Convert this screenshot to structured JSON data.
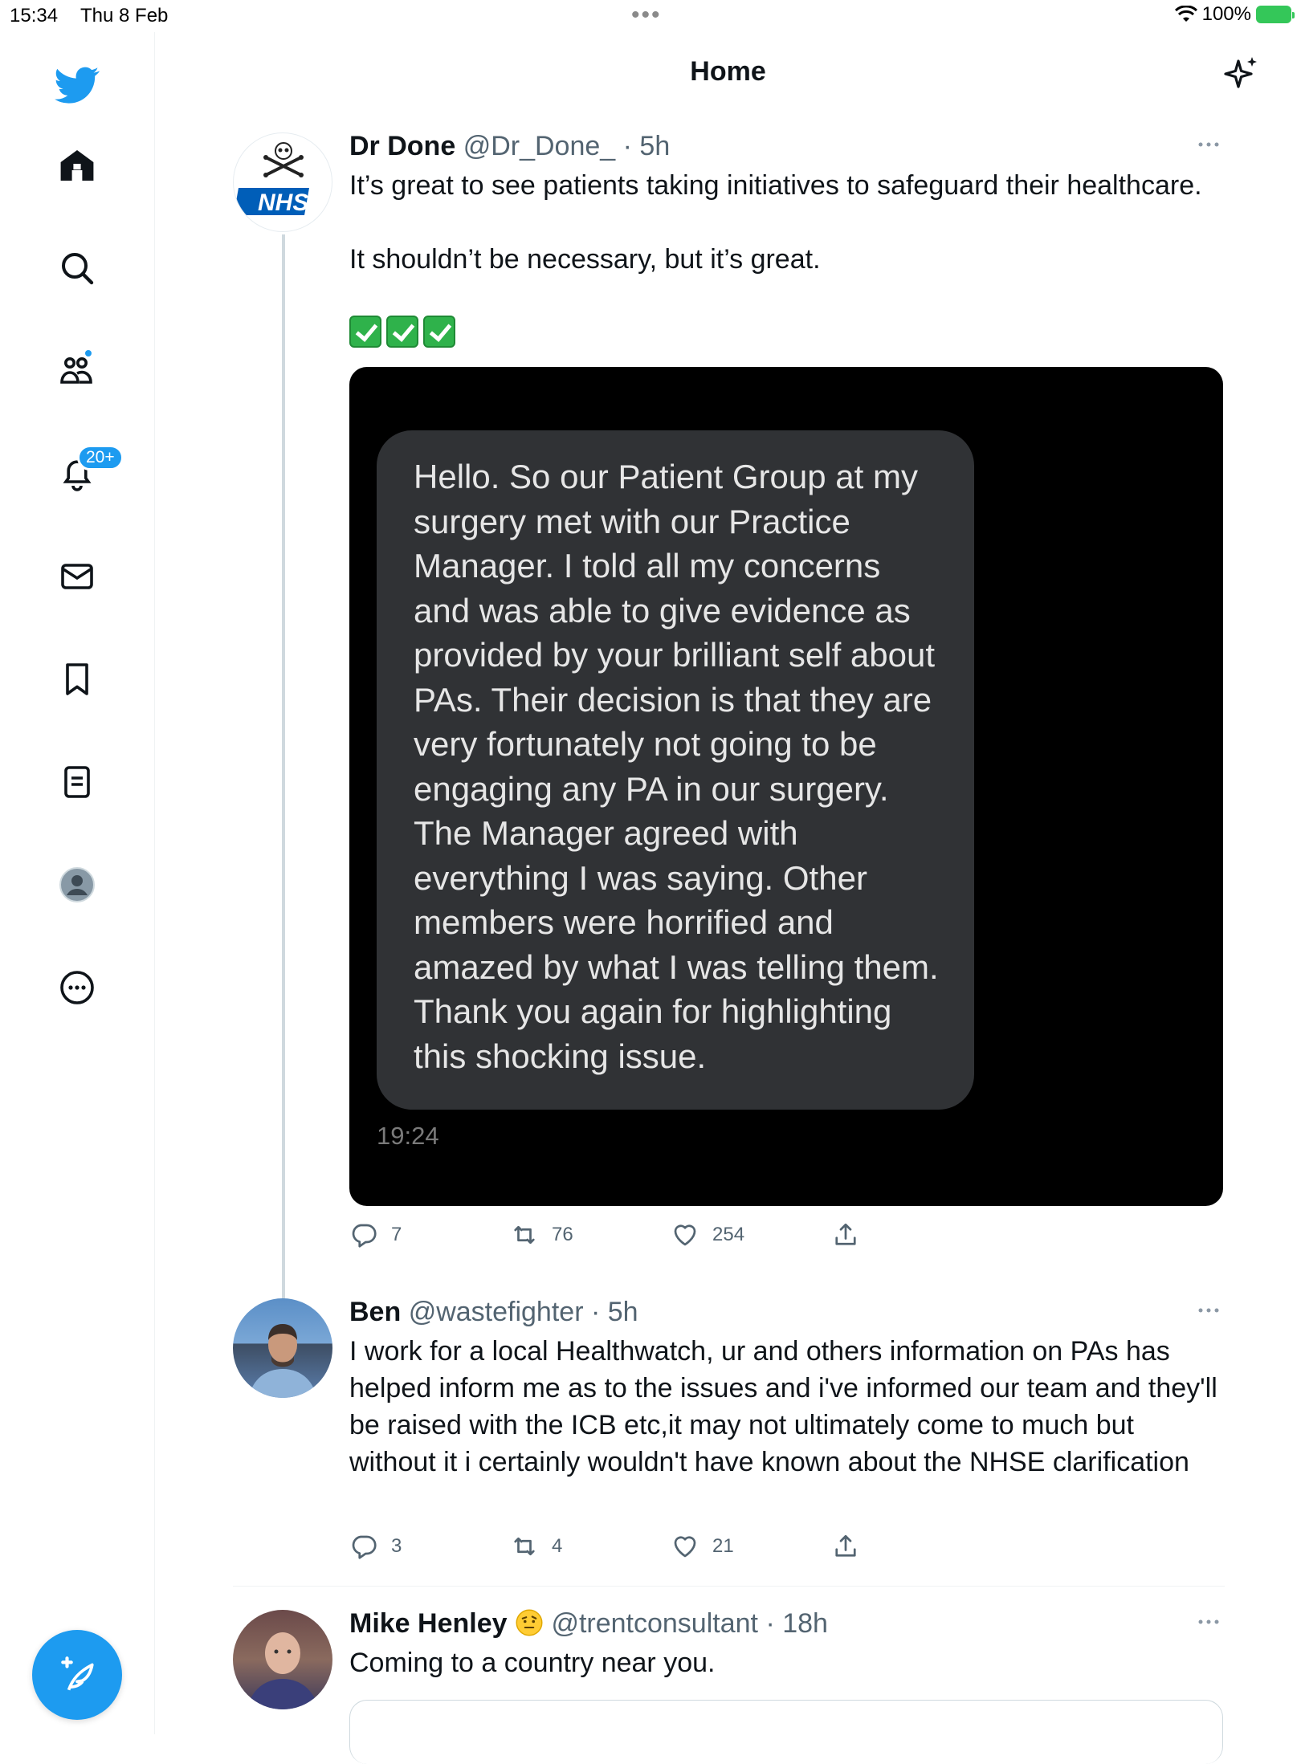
{
  "status_bar": {
    "time": "15:34",
    "date": "Thu 8 Feb",
    "battery": "100%"
  },
  "header": {
    "title": "Home"
  },
  "sidebar": {
    "notifications_badge": "20+",
    "icons": [
      "twitter-logo",
      "home-icon",
      "search-icon",
      "communities-icon",
      "notifications-icon",
      "messages-icon",
      "bookmarks-icon",
      "lists-icon",
      "profile-icon",
      "more-icon"
    ]
  },
  "colors": {
    "accent": "#1d9bf0",
    "text": "#0f1419",
    "muted": "#536471"
  },
  "tweets": [
    {
      "name": "Dr Done",
      "handle": "@Dr_Done_",
      "time": "· 5h",
      "line1": "It’s great to see patients taking initiatives to safeguard their healthcare.",
      "line2": "It shouldn’t be necessary, but it’s great.",
      "media_message": "Hello. So our Patient Group at my surgery met with our Practice Manager. I told all my concerns and was able to give evidence as provided by your brilliant self about PAs. Their decision is that they are very fortunately not going to be engaging any PA in our surgery. The Manager agreed with everything I was saying. Other members were horrified and amazed by what I was telling them. Thank you again for highlighting this shocking issue.",
      "media_time": "19:24",
      "replies": "7",
      "retweets": "76",
      "likes": "254"
    },
    {
      "name": "Ben",
      "handle": "@wastefighter",
      "time": "· 5h",
      "text": "I work for a local Healthwatch, ur and others information on PAs has helped inform me as to the issues and i've informed our team and they'll be raised with the ICB etc,it may not ultimately come to much but without it i certainly wouldn't have known about the NHSE clarification",
      "replies": "3",
      "retweets": "4",
      "likes": "21"
    },
    {
      "name": "Mike Henley",
      "handle": "@trentconsultant",
      "time": "· 18h",
      "text": "Coming to a country near you."
    }
  ]
}
